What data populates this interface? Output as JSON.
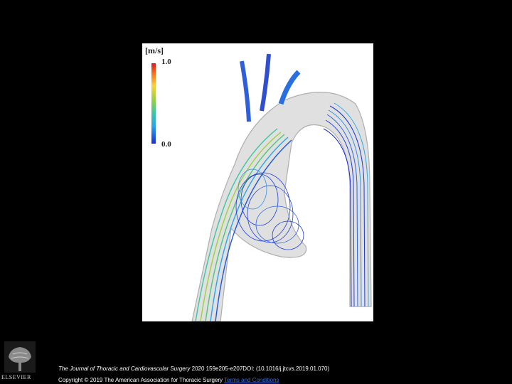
{
  "figure": {
    "colorbar": {
      "unit": "[m/s]",
      "max_label": "1.0",
      "min_label": "0.0"
    },
    "colors": {
      "low": "#1c2fd8",
      "mid": "#9cd142",
      "high": "#d7191c",
      "vessel": "#bdbdbd"
    }
  },
  "publisher_logo": {
    "name": "ELSEVIER",
    "icon": "elsevier-tree-logo"
  },
  "citation": {
    "journal": "The Journal of Thoracic and Cardiovascular Surgery",
    "reference": "2020 159e205-e207DOI: (10.1016/j.jtcvs.2019.01.070)"
  },
  "copyright": {
    "text": "Copyright © 2019 The American Association for Thoracic Surgery",
    "terms_link": "Terms and Conditions"
  }
}
